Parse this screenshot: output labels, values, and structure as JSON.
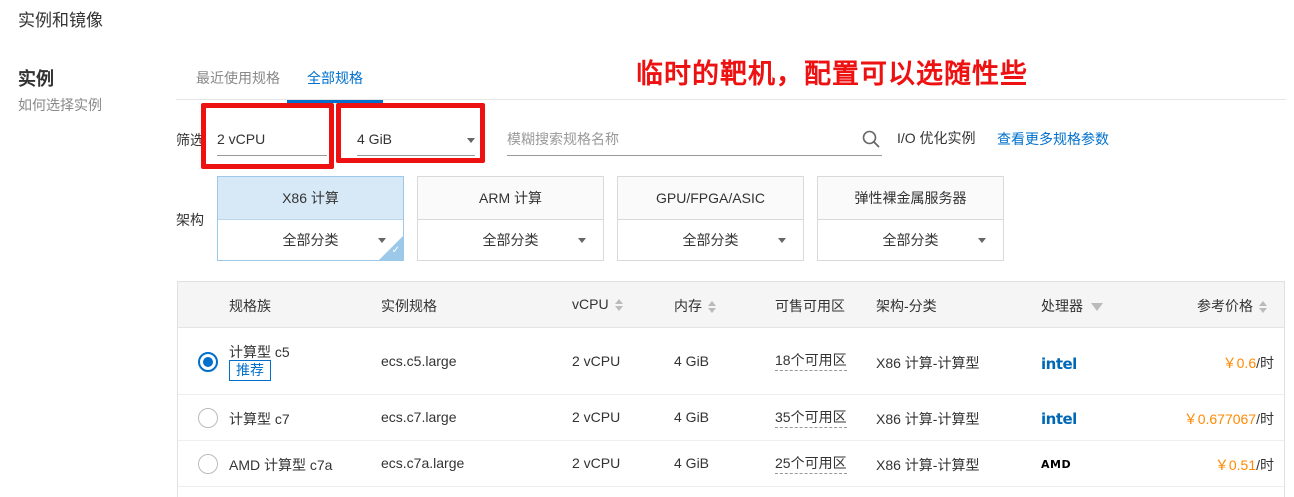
{
  "header": {
    "section_title": "实例和镜像"
  },
  "left": {
    "title": "实例",
    "subtitle": "如何选择实例"
  },
  "tabs": [
    {
      "label": "最近使用规格",
      "active": false
    },
    {
      "label": "全部规格",
      "active": true
    }
  ],
  "annotation": "临时的靶机，配置可以选随性些",
  "filters": {
    "label": "筛选",
    "cpu_value": "2 vCPU",
    "memory_value": "4 GiB",
    "search_placeholder": "模糊搜索规格名称",
    "io_label": "I/O 优化实例",
    "more_link": "查看更多规格参数"
  },
  "architecture": {
    "label": "架构",
    "cards": [
      {
        "title": "X86 计算",
        "category": "全部分类",
        "selected": true
      },
      {
        "title": "ARM 计算",
        "category": "全部分类",
        "selected": false
      },
      {
        "title": "GPU/FPGA/ASIC",
        "category": "全部分类",
        "selected": false
      },
      {
        "title": "弹性裸金属服务器",
        "category": "全部分类",
        "selected": false
      }
    ]
  },
  "table": {
    "columns": {
      "family": "规格族",
      "spec": "实例规格",
      "vcpu": "vCPU",
      "memory": "内存",
      "zones": "可售可用区",
      "arch": "架构-分类",
      "processor": "处理器",
      "price": "参考价格"
    },
    "rows": [
      {
        "selected": true,
        "family": "计算型 c5",
        "badge": "推荐",
        "spec": "ecs.c5.large",
        "vcpu": "2 vCPU",
        "memory": "4 GiB",
        "zones": "18个可用区",
        "arch": "X86 计算-计算型",
        "processor": "intel",
        "price": "￥0.6",
        "price_unit": "/时"
      },
      {
        "selected": false,
        "family": "计算型 c7",
        "badge": "",
        "spec": "ecs.c7.large",
        "vcpu": "2 vCPU",
        "memory": "4 GiB",
        "zones": "35个可用区",
        "arch": "X86 计算-计算型",
        "processor": "intel",
        "price": "￥0.677067",
        "price_unit": "/时"
      },
      {
        "selected": false,
        "family": "AMD 计算型 c7a",
        "badge": "",
        "spec": "ecs.c7a.large",
        "vcpu": "2 vCPU",
        "memory": "4 GiB",
        "zones": "25个可用区",
        "arch": "X86 计算-计算型",
        "processor": "AMD",
        "price": "￥0.51",
        "price_unit": "/时"
      }
    ]
  },
  "colors": {
    "accent": "#0070cc",
    "annotation": "#ee1111",
    "price": "#ff8a00"
  }
}
